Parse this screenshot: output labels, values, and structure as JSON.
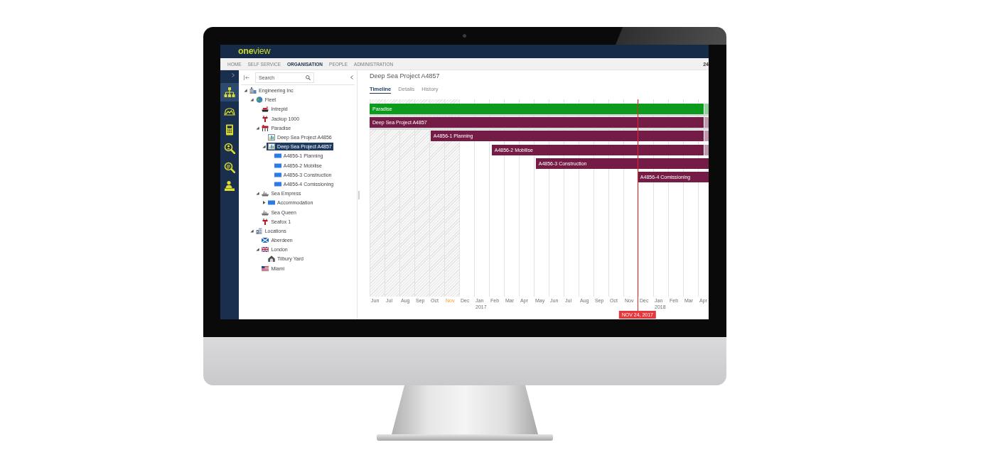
{
  "topbar": {
    "logo": "**one**view"
  },
  "nav": {
    "items": [
      {
        "label": "HOME",
        "selected": false
      },
      {
        "label": "SELF SERVICE",
        "selected": false
      },
      {
        "label": "ORGANISATION",
        "selected": true
      },
      {
        "label": "PEOPLE",
        "selected": false
      },
      {
        "label": "ADMINISTRATION",
        "selected": false
      }
    ],
    "right_text": "24"
  },
  "rail": {
    "items": [
      {
        "kind": "hierarchy",
        "selected": true
      },
      {
        "kind": "landscape",
        "selected": false
      },
      {
        "kind": "calculator",
        "selected": false
      },
      {
        "kind": "personsearch",
        "selected": false
      },
      {
        "kind": "recordsearch",
        "selected": false
      },
      {
        "kind": "desk",
        "selected": false
      }
    ]
  },
  "tree": {
    "search": {
      "placeholder": "Search"
    },
    "nodes": [
      {
        "label": "Engineering Inc",
        "kind": "company",
        "expanded": true,
        "selected": false,
        "children": [
          {
            "label": "Fleet",
            "kind": "globe",
            "expanded": true,
            "selected": false,
            "children": [
              {
                "label": "Intrepid",
                "kind": "vessel",
                "selected": false
              },
              {
                "label": "Jackup 1000",
                "kind": "rig",
                "selected": false
              },
              {
                "label": "Paradise",
                "kind": "platform",
                "expanded": true,
                "selected": false,
                "children": [
                  {
                    "label": "Deep Sea Project A4856",
                    "kind": "project",
                    "selected": false
                  },
                  {
                    "label": "Deep Sea Project A4857",
                    "kind": "project",
                    "expanded": true,
                    "selected": true,
                    "children": [
                      {
                        "label": "A4856-1 Planning",
                        "kind": "task",
                        "selected": false
                      },
                      {
                        "label": "A4856-2 Mobilise",
                        "kind": "task",
                        "selected": false
                      },
                      {
                        "label": "A4856-3 Construction",
                        "kind": "task",
                        "selected": false
                      },
                      {
                        "label": "A4856-4 Comissioning",
                        "kind": "task",
                        "selected": false
                      }
                    ]
                  }
                ]
              },
              {
                "label": "Sea Empress",
                "kind": "ship",
                "expanded": true,
                "selected": false,
                "children": [
                  {
                    "label": "Accommodation",
                    "kind": "task",
                    "expanded": false,
                    "selected": false
                  }
                ]
              },
              {
                "label": "Sea Queen",
                "kind": "ship",
                "selected": false
              },
              {
                "label": "Seafox 1",
                "kind": "rig",
                "selected": false
              }
            ]
          },
          {
            "label": "Locations",
            "kind": "city",
            "expanded": true,
            "selected": false,
            "children": [
              {
                "label": "Aberdeen",
                "kind": "saltire",
                "selected": false
              },
              {
                "label": "London",
                "kind": "unionjack",
                "expanded": true,
                "selected": false,
                "children": [
                  {
                    "label": "Tilbury Yard",
                    "kind": "depot",
                    "selected": false
                  }
                ]
              },
              {
                "label": "Miami",
                "kind": "stars",
                "selected": false
              }
            ]
          }
        ]
      }
    ]
  },
  "main": {
    "title": "Deep Sea Project A4857",
    "tabs": [
      {
        "label": "Timeline",
        "selected": true
      },
      {
        "label": "Details",
        "selected": false
      },
      {
        "label": "History",
        "selected": false
      }
    ],
    "timeline": {
      "months": [
        {
          "label": "Jun",
          "shaded": true,
          "highlighted": false
        },
        {
          "label": "Jul",
          "shaded": true,
          "highlighted": false
        },
        {
          "label": "Aug",
          "shaded": true,
          "highlighted": false
        },
        {
          "label": "Sep",
          "shaded": true,
          "highlighted": false
        },
        {
          "label": "Oct",
          "shaded": true,
          "highlighted": false
        },
        {
          "label": "Nov",
          "shaded": true,
          "highlighted": true
        },
        {
          "label": "Dec",
          "shaded": false,
          "highlighted": false
        },
        {
          "label": "Jan",
          "year": "2017",
          "shaded": false,
          "highlighted": false
        },
        {
          "label": "Feb",
          "shaded": false,
          "highlighted": false
        },
        {
          "label": "Mar",
          "shaded": false,
          "highlighted": false
        },
        {
          "label": "Apr",
          "shaded": false,
          "highlighted": false
        },
        {
          "label": "May",
          "shaded": false,
          "highlighted": false
        },
        {
          "label": "Jun",
          "shaded": false,
          "highlighted": false
        },
        {
          "label": "Jul",
          "shaded": false,
          "highlighted": false
        },
        {
          "label": "Aug",
          "shaded": false,
          "highlighted": false
        },
        {
          "label": "Sep",
          "shaded": false,
          "highlighted": false
        },
        {
          "label": "Oct",
          "shaded": false,
          "highlighted": false
        },
        {
          "label": "Nov",
          "shaded": false,
          "highlighted": false
        },
        {
          "label": "Dec",
          "shaded": false,
          "highlighted": false
        },
        {
          "label": "Jan",
          "year": "2018",
          "shaded": false,
          "highlighted": false
        },
        {
          "label": "Feb",
          "shaded": false,
          "highlighted": false
        },
        {
          "label": "Mar",
          "shaded": false,
          "highlighted": false
        },
        {
          "label": "Apr",
          "shaded": false,
          "highlighted": false
        }
      ],
      "today": {
        "label": "NOV 24, 2017",
        "level": 0.79
      },
      "bars": [
        {
          "label": "Paradise",
          "kind": "summary",
          "color": "#0d9b1e",
          "level": 1,
          "faded_tail": true
        },
        {
          "label": "Deep Sea Project A4857",
          "kind": "summary",
          "color": "#751c46",
          "level": 1,
          "faded_tail": true
        },
        {
          "label": "A4856-1 Planning",
          "kind": "task",
          "color": "#751c46",
          "level": 0.82,
          "faded_tail": true
        },
        {
          "label": "A4856-2 Mobilise",
          "kind": "task",
          "color": "#751c46",
          "level": 0.64,
          "faded_tail": true
        },
        {
          "label": "A4856-3 Construction",
          "kind": "task",
          "color": "#751c46",
          "level": 0.51,
          "faded_tail": false
        },
        {
          "label": "A4856-4 Comissioning",
          "kind": "task",
          "color": "#751c46",
          "level": 0.21,
          "faded_tail": false
        }
      ]
    }
  }
}
